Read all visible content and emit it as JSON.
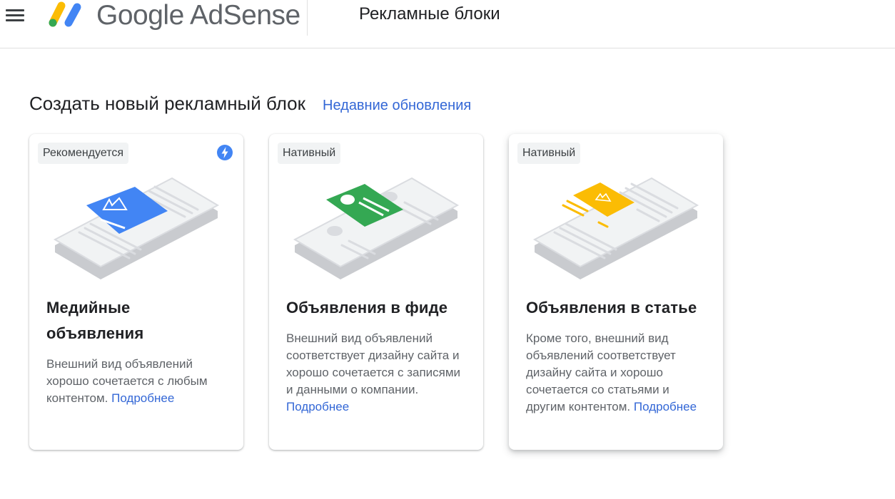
{
  "header": {
    "logo_text": "Google AdSense",
    "page_title": "Рекламные блоки"
  },
  "section": {
    "title": "Создать новый рекламный блок",
    "link": "Недавние обновления"
  },
  "cards": [
    {
      "badge": "Рекомендуется",
      "title": "Медийные объявления",
      "description": "Внешний вид объявлений хорошо сочетается с любым контентом.",
      "link": "Подробнее",
      "accent": "#4285f4"
    },
    {
      "badge": "Нативный",
      "title": "Объявления в фиде",
      "description": "Внешний вид объявлений соответствует дизайну сайта и хорошо сочетается с записями и данными о компании.",
      "link": "Подробнее",
      "accent": "#34a853"
    },
    {
      "badge": "Нативный",
      "title": "Объявления в статье",
      "description": "Кроме того, внешний вид объявлений соответствует дизайну сайта и хорошо сочетается со статьями и другим контентом.",
      "link": "Подробнее",
      "accent": "#fbbc04"
    }
  ],
  "icons": {
    "menu": "hamburger-menu-icon",
    "logo": "adsense-logo-icon",
    "recommended": "lightning-bolt-icon"
  },
  "colors": {
    "link": "#3367d6",
    "blue": "#4285f4",
    "green": "#34a853",
    "yellow": "#fbbc04"
  }
}
